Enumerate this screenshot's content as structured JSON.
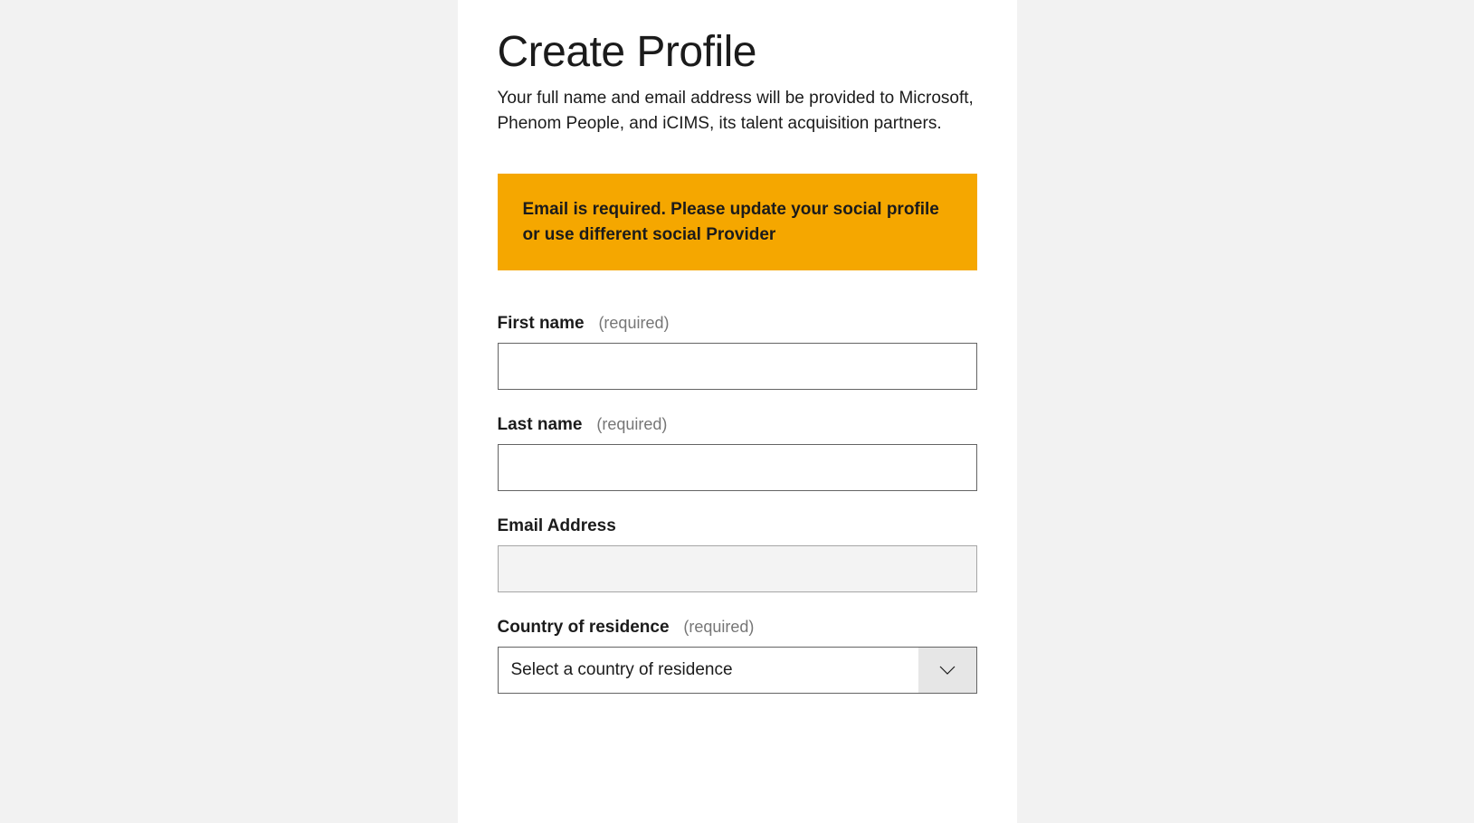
{
  "page": {
    "title": "Create Profile",
    "description": "Your full name and email address will be provided to Microsoft, Phenom People, and iCIMS, its talent acquisition partners."
  },
  "alert": {
    "message": "Email is required. Please update your social profile or use different social Provider"
  },
  "form": {
    "firstName": {
      "label": "First name",
      "required": "(required)",
      "value": ""
    },
    "lastName": {
      "label": "Last name",
      "required": "(required)",
      "value": ""
    },
    "email": {
      "label": "Email Address",
      "value": ""
    },
    "country": {
      "label": "Country of residence",
      "required": "(required)",
      "placeholder": "Select a country of residence"
    }
  }
}
